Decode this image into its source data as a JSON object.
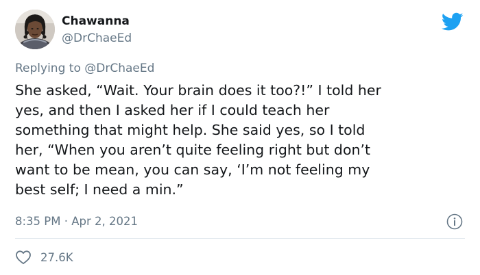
{
  "author": {
    "display_name": "Chawanna",
    "handle": "@DrChaeEd"
  },
  "reply": {
    "prefix": "Replying to ",
    "mention": "@DrChaeEd"
  },
  "tweet": {
    "lines": [
      "She asked, “Wait. Your brain does it too?!” I told her",
      "yes, and then I asked her if I could teach her",
      "something that might help. She said yes, so I told",
      "her, “When you aren’t quite feeling right but don’t",
      "want to be mean, you can say, ‘I’m not feeling my",
      "best self; I need a min.”"
    ],
    "timestamp": "8:35 PM · Apr 2, 2021",
    "likes": "27.6K"
  },
  "icons": {
    "brand": "twitter-bird-icon",
    "info": "info-icon",
    "like": "heart-icon"
  },
  "colors": {
    "brand_blue": "#1da1f2",
    "text_primary": "#14171a",
    "text_secondary": "#657786",
    "divider": "#e1e8ed"
  }
}
